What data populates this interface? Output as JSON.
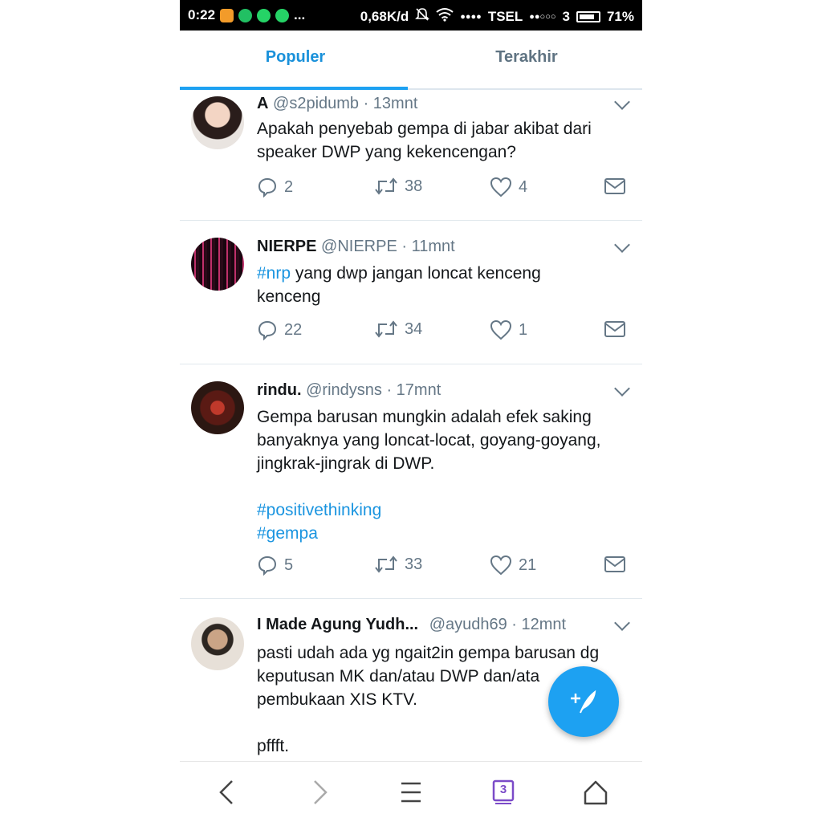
{
  "status_bar": {
    "time": "0:22",
    "more": "...",
    "speed": "0,68K/d",
    "carrier1": "TSEL",
    "carrier2": "3",
    "battery": "71%"
  },
  "tabs": [
    {
      "label": "Populer",
      "active": true
    },
    {
      "label": "Terakhir",
      "active": false
    }
  ],
  "tweets": [
    {
      "name": "A",
      "meta": "@s2pidumb · 13mnt",
      "text_lines": [
        "Apakah penyebab gempa di jabar akibat dari",
        "speaker DWP yang kekencengan?"
      ],
      "replies": "2",
      "retweets": "38",
      "likes": "4"
    },
    {
      "name": "NIERPE",
      "meta": "@NIERPE · 11mnt",
      "hashtag": "#nrp",
      "text_first_rest": " yang dwp jangan loncat kenceng",
      "text_line2": "kenceng",
      "replies": "22",
      "retweets": "34",
      "likes": "1"
    },
    {
      "name": "rindu.",
      "meta": "@rindysns · 17mnt",
      "text_lines": [
        "Gempa barusan mungkin adalah efek saking",
        "banyaknya yang loncat-locat, goyang-goyang,",
        "jingkrak-jingrak di DWP."
      ],
      "hashtags": [
        "#positivethinking",
        "#gempa"
      ],
      "replies": "5",
      "retweets": "33",
      "likes": "21"
    },
    {
      "name": "I Made Agung Yudh...",
      "meta": "@ayudh69 · 12mnt",
      "text_lines": [
        "pasti udah ada yg ngait2in gempa barusan dg",
        "keputusan MK dan/atau DWP dan/ata",
        "pembukaan XIS KTV."
      ],
      "text_after": "pffft."
    }
  ],
  "bottom_nav": {
    "tab_count": "3"
  },
  "colors": {
    "accent": "#1da1f2",
    "link": "#1b95e0",
    "muted": "#657786",
    "text": "#14171a"
  },
  "icons": [
    "reply-icon",
    "retweet-icon",
    "like-icon",
    "dm-icon",
    "caret-down-icon",
    "compose-icon",
    "back-icon",
    "forward-icon",
    "menu-icon",
    "tabs-icon",
    "home-icon"
  ]
}
